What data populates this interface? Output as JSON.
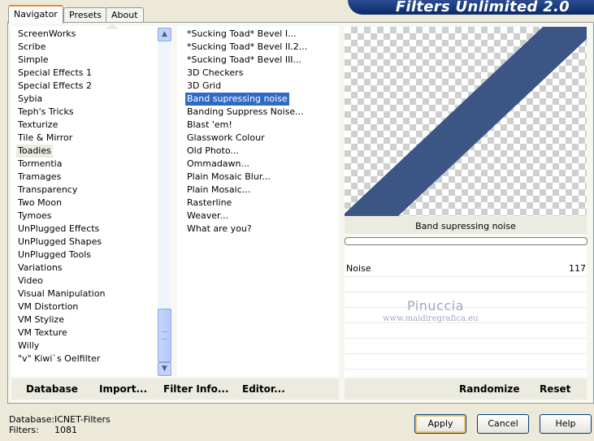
{
  "tabs": [
    "Navigator",
    "Presets",
    "About"
  ],
  "banner": {
    "title": "Filters Unlimited 2.0"
  },
  "categories": [
    "ScreenWorks",
    "Scribe",
    "Simple",
    "Special Effects 1",
    "Special Effects 2",
    "Sybia",
    "Teph's Tricks",
    "Texturize",
    "Tile & Mirror",
    "Toadies",
    "Tormentia",
    "Tramages",
    "Transparency",
    "Two Moon",
    "Tymoes",
    "UnPlugged Effects",
    "UnPlugged Shapes",
    "UnPlugged Tools",
    "Variations",
    "Video",
    "Visual Manipulation",
    "VM Distortion",
    "VM Stylize",
    "VM Texture",
    "Willy",
    "\"v\" Kiwi`s Oelfilter"
  ],
  "selected_category": "Toadies",
  "filters": [
    "*Sucking Toad*  Bevel I...",
    "*Sucking Toad*  Bevel II.2...",
    "*Sucking Toad*  Bevel III...",
    "3D Checkers",
    "3D Grid",
    "Band supressing noise",
    "Banding Suppress Noise...",
    "Blast 'em!",
    "Glasswork Colour",
    "Old Photo...",
    "Ommadawn...",
    "Plain Mosaic Blur...",
    "Plain Mosaic...",
    "Rasterline",
    "Weaver...",
    "What are you?"
  ],
  "selected_filter": "Band supressing noise",
  "preview": {
    "filter_name": "Band supressing noise",
    "stripe_color": "#3b5585"
  },
  "param": {
    "name": "Noise",
    "value": "117"
  },
  "watermark": {
    "line1": "Pinuccia",
    "line2": "www.maidiregrafica.eu"
  },
  "bottom_left_buttons": [
    "Database",
    "Import...",
    "Filter Info...",
    "Editor..."
  ],
  "bottom_right_buttons": [
    "Randomize",
    "Reset"
  ],
  "info": {
    "database_label": "Database:",
    "database_value": "ICNET-Filters",
    "filters_label": "Filters:",
    "filters_value": "1081"
  },
  "buttons": {
    "apply": "Apply",
    "cancel": "Cancel",
    "help": "Help"
  },
  "colors": {
    "selection": "#316ac5",
    "panel": "#ece9d8"
  }
}
